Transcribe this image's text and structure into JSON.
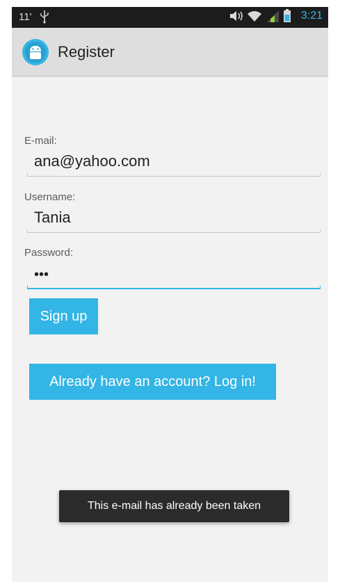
{
  "status_bar": {
    "left_text": "11'",
    "time": "3:21",
    "icons": [
      "usb-icon",
      "volume-icon",
      "wifi-icon",
      "signal-icon",
      "battery-icon"
    ]
  },
  "action_bar": {
    "title": "Register",
    "icon": "android-app-icon"
  },
  "form": {
    "email": {
      "label": "E-mail:",
      "value": "ana@yahoo.com"
    },
    "username": {
      "label": "Username:",
      "value": "Tania"
    },
    "password": {
      "label": "Password:",
      "value": "•••"
    }
  },
  "buttons": {
    "sign_up": "Sign up",
    "login": "Already have an account? Log in!"
  },
  "toast": {
    "message": "This e-mail has already been taken"
  },
  "colors": {
    "accent": "#33b5e5",
    "status_bar": "#1c1c1c",
    "action_bar": "#dedede",
    "background": "#f2f2f2",
    "toast": "#2b2b2b"
  }
}
